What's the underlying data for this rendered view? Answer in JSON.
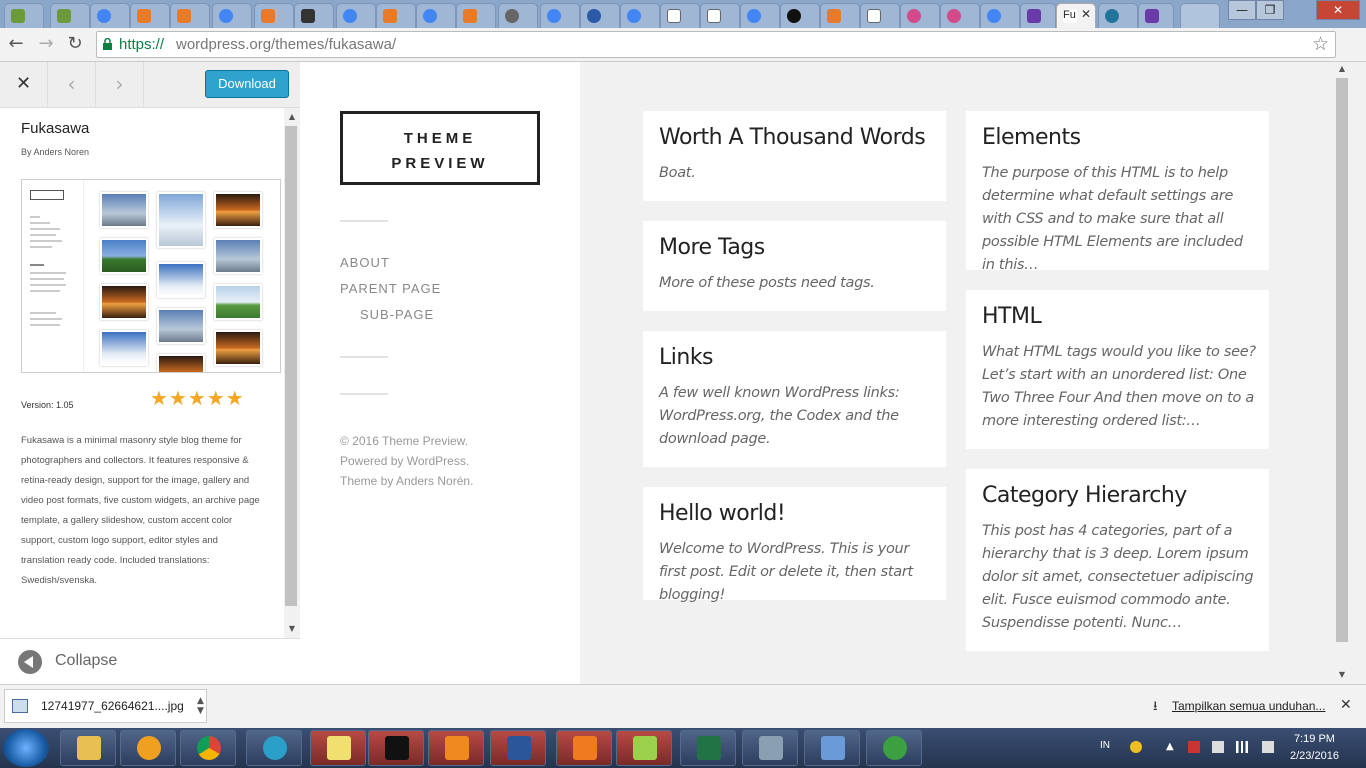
{
  "browser": {
    "active_tab_title": "Fu",
    "url_scheme": "https://",
    "url_rest": "wordpress.org/themes/fukasawa/",
    "window_controls": [
      "—",
      "❐",
      "✕"
    ]
  },
  "customizer": {
    "download_label": "Download",
    "theme_name": "Fukasawa",
    "author": "By Anders Noren",
    "version": "Version: 1.05",
    "rating_stars": "★★★★★",
    "rating": 5,
    "description": "Fukasawa is a minimal masonry style blog theme for photographers and collectors. It features responsive & retina-ready design, support for the image, gallery and video post formats, five custom widgets, an archive page template, a gallery slideshow, custom accent color support, custom logo support, editor styles and translation ready code. Included translations: Swedish/svenska.",
    "collapse_label": "Collapse"
  },
  "preview": {
    "logo_line1": "THEME",
    "logo_line2": "PREVIEW",
    "nav": [
      "ABOUT",
      "PARENT PAGE",
      "SUB-PAGE"
    ],
    "credit1": "© 2016 Theme Preview.",
    "credit2": "Powered by WordPress.",
    "credit3": "Theme by Anders Norén.",
    "posts_left": [
      {
        "title": "Worth A Thousand Words",
        "excerpt": "Boat."
      },
      {
        "title": "More Tags",
        "excerpt": "More of these posts need tags."
      },
      {
        "title": "Links",
        "excerpt": "A few well known WordPress links: WordPress.org, the Codex and the download page."
      },
      {
        "title": "Hello world!",
        "excerpt": "Welcome to WordPress. This is your first post. Edit or delete it, then start blogging!"
      }
    ],
    "posts_right": [
      {
        "title": "Elements",
        "excerpt": "The purpose of this HTML is to help determine what default settings are with CSS and to make sure that all possible HTML Elements are included in this…"
      },
      {
        "title": "HTML",
        "excerpt": "What HTML tags would you like to see? Let’s start with an unordered list: One Two Three Four And then move on to a more interesting ordered list:…"
      },
      {
        "title": "Category Hierarchy",
        "excerpt": "This post has 4 categories, part of a hierarchy that is 3 deep. Lorem ipsum dolor sit amet, consectetuer adipiscing elit. Fusce euismod commodo ante. Suspendisse potenti. Nunc…"
      }
    ]
  },
  "downloads": {
    "filename": "12741977_62664621....jpg",
    "show_all": "Tampilkan semua unduhan..."
  },
  "taskbar": {
    "lang": "IN",
    "time": "7:19 PM",
    "date": "2/23/2016"
  }
}
